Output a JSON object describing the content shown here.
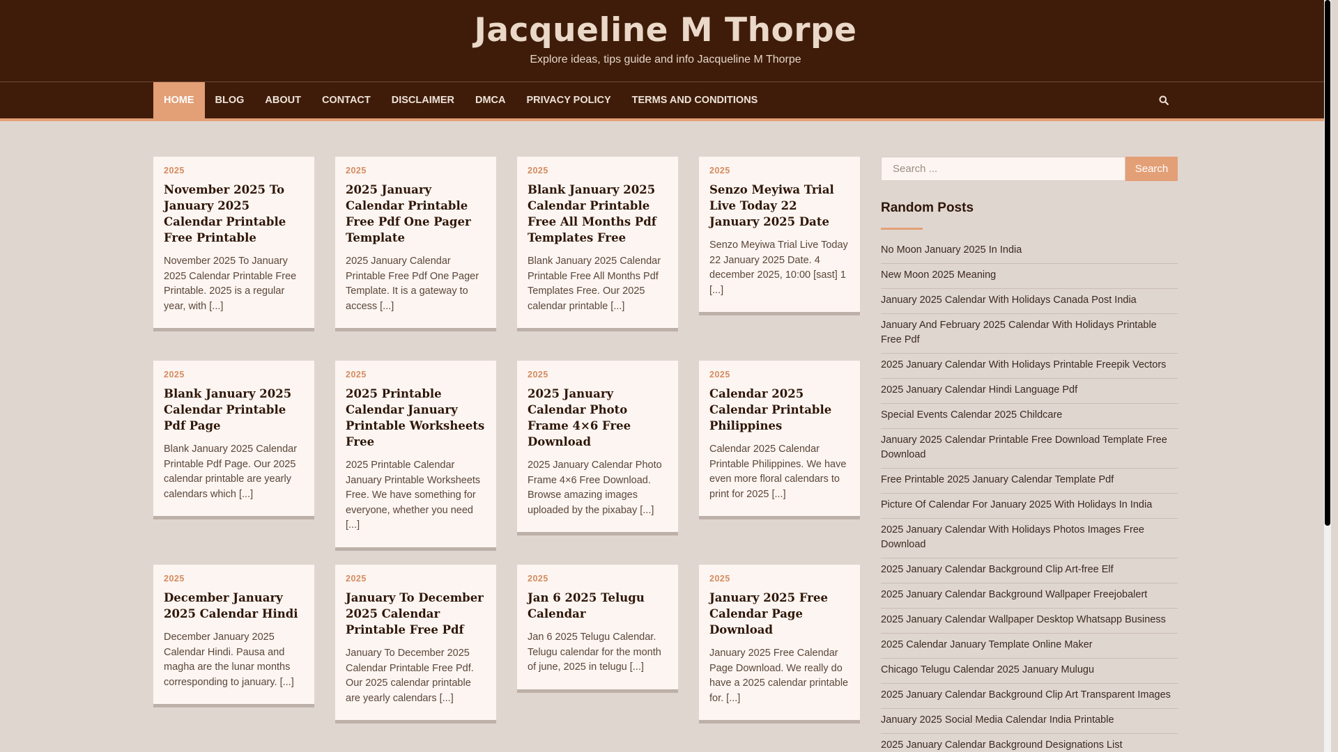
{
  "header": {
    "title": "Jacqueline M Thorpe",
    "tagline": "Explore ideas, tips guide and info Jacqueline M Thorpe"
  },
  "nav": {
    "items": [
      "HOME",
      "BLOG",
      "ABOUT",
      "CONTACT",
      "DISCLAIMER",
      "DMCA",
      "PRIVACY POLICY",
      "TERMS AND CONDITIONS"
    ],
    "active": "HOME",
    "search_icon": "search-icon"
  },
  "posts": [
    {
      "category": "2025",
      "title": "November 2025 To January 2025 Calendar Printable Free Printable",
      "excerpt": "November 2025 To January 2025 Calendar Printable Free Printable. 2025 is a regular year, with [...]"
    },
    {
      "category": "2025",
      "title": "2025 January Calendar Printable Free Pdf One Pager Template",
      "excerpt": "2025 January Calendar Printable Free Pdf One Pager Template. It is a gateway to access [...]"
    },
    {
      "category": "2025",
      "title": "Blank January 2025 Calendar Printable Free All Months Pdf Templates Free",
      "excerpt": "Blank January 2025 Calendar Printable Free All Months Pdf Templates Free. Our 2025 calendar printable [...]"
    },
    {
      "category": "2025",
      "title": "Senzo Meyiwa Trial Live Today 22 January 2025 Date",
      "excerpt": "Senzo Meyiwa Trial Live Today 22 January 2025 Date. 4 december 2025, 10:00 [sast] 1 [...]"
    },
    {
      "category": "2025",
      "title": "Blank January 2025 Calendar Printable Pdf Page",
      "excerpt": "Blank January 2025 Calendar Printable Pdf Page. Our 2025 calendar printable are yearly calendars which [...]"
    },
    {
      "category": "2025",
      "title": "2025 Printable Calendar January Printable Worksheets Free",
      "excerpt": "2025 Printable Calendar January Printable Worksheets Free. We have something for everyone, whether you need [...]"
    },
    {
      "category": "2025",
      "title": "2025 January Calendar Photo Frame 4×6 Free Download",
      "excerpt": "2025 January Calendar Photo Frame 4×6 Free Download. Browse amazing images uploaded by the pixabay [...]"
    },
    {
      "category": "2025",
      "title": "Calendar 2025 Calendar Printable Philippines",
      "excerpt": "Calendar 2025 Calendar Printable Philippines. We have even more floral calendars to print for 2025 [...]"
    },
    {
      "category": "2025",
      "title": "December January 2025 Calendar Hindi",
      "excerpt": "December January 2025 Calendar Hindi. Pausa and magha are the lunar months corresponding to january. [...]"
    },
    {
      "category": "2025",
      "title": "January To December 2025 Calendar Printable Free Pdf",
      "excerpt": "January To December 2025 Calendar Printable Free Pdf. Our 2025 calendar printable are yearly calendars [...]"
    },
    {
      "category": "2025",
      "title": "Jan 6 2025 Telugu Calendar",
      "excerpt": "Jan 6 2025 Telugu Calendar. Telugu calendar for the month of june, 2025 in telugu [...]"
    },
    {
      "category": "2025",
      "title": "January 2025 Free Calendar Page Download",
      "excerpt": "January 2025 Free Calendar Page Download. We really do have a 2025 calendar printable for. [...]"
    }
  ],
  "sidebar": {
    "search_placeholder": "Search ...",
    "search_button": "Search",
    "random_title": "Random Posts",
    "random_posts": [
      "No Moon January 2025 In India",
      "New Moon 2025 Meaning",
      "January 2025 Calendar With Holidays Canada Post India",
      "January And February 2025 Calendar With Holidays Printable Free Pdf",
      "2025 January Calendar With Holidays Printable Freepik Vectors",
      "2025 January Calendar Hindi Language Pdf",
      "Special Events Calendar 2025 Childcare",
      "January 2025 Calendar Printable Free Download Template Free Download",
      "Free Printable 2025 January Calendar Template Pdf",
      "Picture Of Calendar For January 2025 With Holidays In India",
      "2025 January Calendar With Holidays Photos Images Free Download",
      "2025 January Calendar Background Clip Art-free Elf",
      "2025 January Calendar Background Wallpaper Freejobalert",
      "2025 January Calendar Wallpaper Desktop Whatsapp Business",
      "2025 Calendar January Template Online Maker",
      "Chicago Telugu Calendar 2025 January Mulugu",
      "2025 January Calendar Background Clip Art Transparent Images",
      "January 2025 Social Media Calendar India Printable",
      "2025 January Calendar Background Designations List"
    ]
  },
  "colors": {
    "header_bg": "#3f1c0a",
    "accent": "#e39f76",
    "page_bg": "#e0d6d0",
    "card_bg": "#fdf5f1"
  }
}
